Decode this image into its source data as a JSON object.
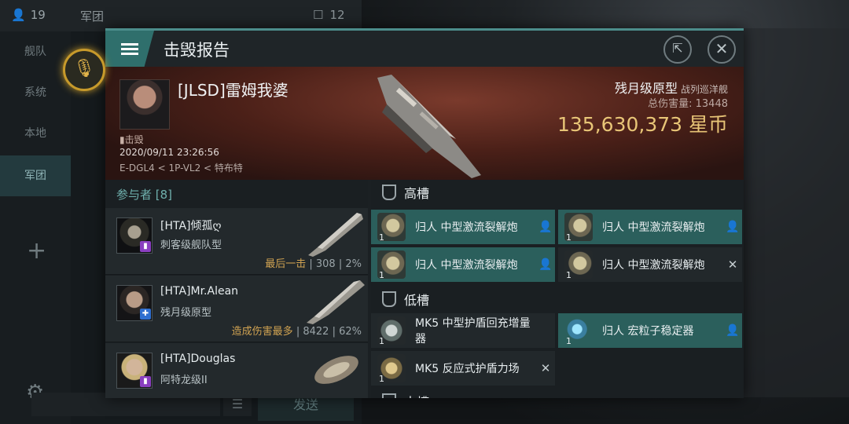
{
  "background": {
    "member_count": "19",
    "channel_title": "军团",
    "channel_count": "12",
    "sidebar": [
      "舰队",
      "系统",
      "本地",
      "军团"
    ],
    "send_label": "发送"
  },
  "modal": {
    "title": "击毁报告",
    "victim": {
      "name": "[JLSD]雷姆我婆",
      "status": "击毁",
      "time": "2020/09/11 23:26:56",
      "location": "E-DGL4 < 1P-VL2 < 特布特",
      "ship_class": "残月级原型",
      "ship_type": "战列巡洋舰",
      "damage_label": "总伤害量:",
      "damage_value": "13448",
      "isk_value": "135,630,373 星币"
    },
    "participants": {
      "header": "参与者 [8]",
      "rows": [
        {
          "name": "[HTA]倾孤ღ",
          "ship": "刺客级舰队型",
          "tag": "最后一击",
          "damage": "308",
          "percent": "2%",
          "badge_color": "#8a3fc0",
          "badge_symbol": "▮"
        },
        {
          "name": "[HTA]Mr.Alean",
          "ship": "残月级原型",
          "tag": "造成伤害最多",
          "damage": "8422",
          "percent": "62%",
          "badge_color": "#2f6fd0",
          "badge_symbol": "✚"
        },
        {
          "name": "[HTA]Douglas",
          "ship": "阿特龙级II",
          "tag": "",
          "damage": "",
          "percent": "",
          "badge_color": "#8a3fc0",
          "badge_symbol": "▮"
        }
      ]
    },
    "high_slots": {
      "label": "高槽",
      "modules": [
        {
          "name": "归人 中型激流裂解炮",
          "qty": "1",
          "state": "active",
          "status": "person-icon"
        },
        {
          "name": "归人 中型激流裂解炮",
          "qty": "1",
          "state": "active",
          "status": "person-icon"
        },
        {
          "name": "归人 中型激流裂解炮",
          "qty": "1",
          "state": "active",
          "status": "person-icon"
        },
        {
          "name": "归人 中型激流裂解炮",
          "qty": "1",
          "state": "dark",
          "status": "destroyed-icon"
        }
      ]
    },
    "low_slots": {
      "label": "低槽",
      "modules": [
        {
          "name": "MK5 中型护盾回充增量器",
          "qty": "1",
          "state": "dark",
          "status": ""
        },
        {
          "name": "归人 宏粒子稳定器",
          "qty": "1",
          "state": "active",
          "status": "person-icon"
        },
        {
          "name": "MK5 反应式护盾力场",
          "qty": "1",
          "state": "dark",
          "status": "destroyed-icon"
        }
      ]
    },
    "mid_slots": {
      "label": "中槽"
    }
  },
  "colors": {
    "accent": "#2f6f6c",
    "module_active": "#2b5f5c",
    "isk": "#e8c577",
    "tag": "#d1a352"
  }
}
